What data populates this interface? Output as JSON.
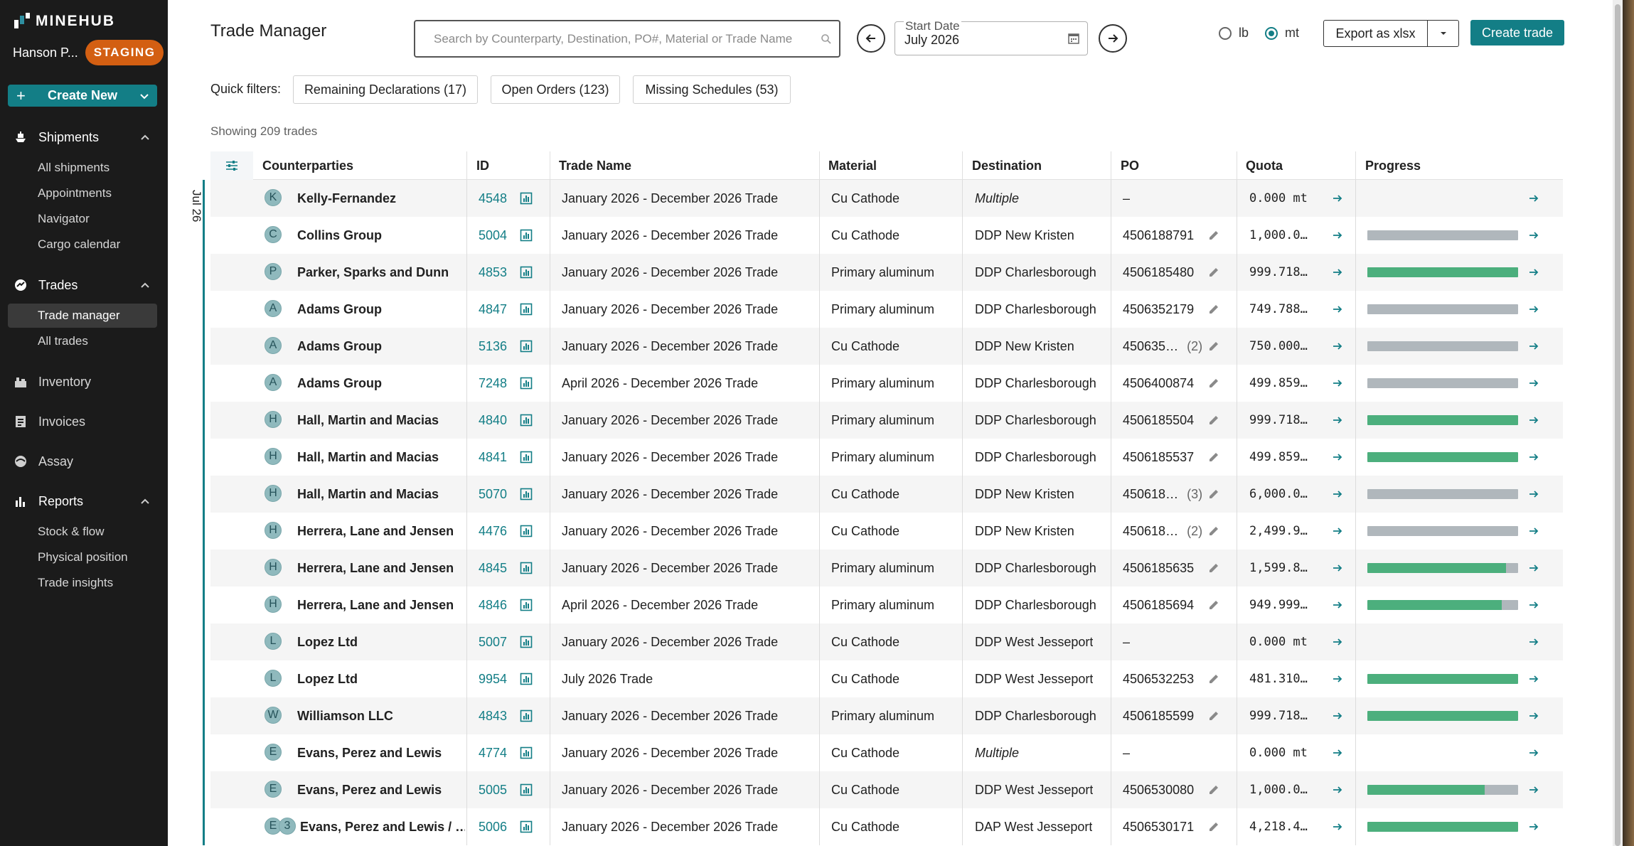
{
  "brand": {
    "name": "MINEHUB"
  },
  "user": {
    "name": "Hanson P...",
    "env_badge": "STAGING"
  },
  "sidebar": {
    "create_new": "Create New",
    "sections": [
      {
        "label": "Shipments",
        "icon": "ship-icon",
        "items": [
          "All shipments",
          "Appointments",
          "Navigator",
          "Cargo calendar"
        ]
      },
      {
        "label": "Trades",
        "icon": "trades-icon",
        "items": [
          "Trade manager",
          "All trades"
        ],
        "active_item": "Trade manager"
      },
      {
        "label": "Inventory",
        "icon": "inventory-icon",
        "items": []
      },
      {
        "label": "Invoices",
        "icon": "invoice-icon",
        "items": []
      },
      {
        "label": "Assay",
        "icon": "assay-icon",
        "items": []
      },
      {
        "label": "Reports",
        "icon": "reports-icon",
        "items": [
          "Stock & flow",
          "Physical position",
          "Trade insights"
        ]
      }
    ]
  },
  "header": {
    "title": "Trade Manager",
    "search_placeholder": "Search by Counterparty, Destination, PO#, Material or Trade Name",
    "start_date_label": "Start Date",
    "start_date_value": "July 2026",
    "unit_lb": "lb",
    "unit_mt": "mt",
    "selected_unit": "mt",
    "export_label": "Export as xlsx",
    "create_trade_label": "Create trade"
  },
  "quick_filters": {
    "label": "Quick filters:",
    "chips": [
      "Remaining Declarations (17)",
      "Open Orders (123)",
      "Missing Schedules (53)"
    ]
  },
  "showing_text": "Showing 209 trades",
  "table": {
    "month_label": "Jul 26",
    "columns": [
      "Counterparties",
      "ID",
      "Trade Name",
      "Material",
      "Destination",
      "PO",
      "Quota",
      "Progress"
    ],
    "rows": [
      {
        "avatars": [
          "K"
        ],
        "counterparty": "Kelly-Fernandez",
        "id": "4548",
        "trade_name": "January 2026 - December 2026 Trade",
        "material": "Cu Cathode",
        "destination": "Multiple",
        "dest_italic": true,
        "po": "–",
        "po_extra": "",
        "po_editable": false,
        "quota": "0.000 mt",
        "progress": []
      },
      {
        "avatars": [
          "C"
        ],
        "counterparty": "Collins Group",
        "id": "5004",
        "trade_name": "January 2026 - December 2026 Trade",
        "material": "Cu Cathode",
        "destination": "DDP New Kristen",
        "dest_italic": false,
        "po": "4506188791",
        "po_extra": "",
        "po_editable": true,
        "quota": "1,000.0…",
        "progress": [
          0,
          1.0
        ]
      },
      {
        "avatars": [
          "P"
        ],
        "counterparty": "Parker, Sparks and Dunn",
        "id": "4853",
        "trade_name": "January 2026 - December 2026 Trade",
        "material": "Primary aluminum",
        "destination": "DDP Charlesborough",
        "dest_italic": false,
        "po": "4506185480",
        "po_extra": "",
        "po_editable": true,
        "quota": "999.718…",
        "progress": [
          1.0,
          0
        ]
      },
      {
        "avatars": [
          "A"
        ],
        "counterparty": "Adams Group",
        "id": "4847",
        "trade_name": "January 2026 - December 2026 Trade",
        "material": "Primary aluminum",
        "destination": "DDP Charlesborough",
        "dest_italic": false,
        "po": "4506352179",
        "po_extra": "",
        "po_editable": true,
        "quota": "749.788…",
        "progress": [
          0,
          1.0
        ]
      },
      {
        "avatars": [
          "A"
        ],
        "counterparty": "Adams Group",
        "id": "5136",
        "trade_name": "January 2026 - December 2026 Trade",
        "material": "Cu Cathode",
        "destination": "DDP New Kristen",
        "dest_italic": false,
        "po": "450635…",
        "po_extra": "(2)",
        "po_editable": true,
        "quota": "750.000…",
        "progress": [
          0,
          1.0
        ]
      },
      {
        "avatars": [
          "A"
        ],
        "counterparty": "Adams Group",
        "id": "7248",
        "trade_name": "April 2026 - December 2026 Trade",
        "material": "Primary aluminum",
        "destination": "DDP Charlesborough",
        "dest_italic": false,
        "po": "4506400874",
        "po_extra": "",
        "po_editable": true,
        "quota": "499.859…",
        "progress": [
          0,
          1.0
        ]
      },
      {
        "avatars": [
          "H"
        ],
        "counterparty": "Hall, Martin and Macias",
        "id": "4840",
        "trade_name": "January 2026 - December 2026 Trade",
        "material": "Primary aluminum",
        "destination": "DDP Charlesborough",
        "dest_italic": false,
        "po": "4506185504",
        "po_extra": "",
        "po_editable": true,
        "quota": "999.718…",
        "progress": [
          1.0,
          0
        ]
      },
      {
        "avatars": [
          "H"
        ],
        "counterparty": "Hall, Martin and Macias",
        "id": "4841",
        "trade_name": "January 2026 - December 2026 Trade",
        "material": "Primary aluminum",
        "destination": "DDP Charlesborough",
        "dest_italic": false,
        "po": "4506185537",
        "po_extra": "",
        "po_editable": true,
        "quota": "499.859…",
        "progress": [
          1.0,
          0
        ]
      },
      {
        "avatars": [
          "H"
        ],
        "counterparty": "Hall, Martin and Macias",
        "id": "5070",
        "trade_name": "January 2026 - December 2026 Trade",
        "material": "Cu Cathode",
        "destination": "DDP New Kristen",
        "dest_italic": false,
        "po": "450618…",
        "po_extra": "(3)",
        "po_editable": true,
        "quota": "6,000.0…",
        "progress": [
          0,
          1.0
        ]
      },
      {
        "avatars": [
          "H"
        ],
        "counterparty": "Herrera, Lane and Jensen",
        "id": "4476",
        "trade_name": "January 2026 - December 2026 Trade",
        "material": "Cu Cathode",
        "destination": "DDP New Kristen",
        "dest_italic": false,
        "po": "450618…",
        "po_extra": "(2)",
        "po_editable": true,
        "quota": "2,499.9…",
        "progress": [
          0,
          1.0
        ]
      },
      {
        "avatars": [
          "H"
        ],
        "counterparty": "Herrera, Lane and Jensen",
        "id": "4845",
        "trade_name": "January 2026 - December 2026 Trade",
        "material": "Primary aluminum",
        "destination": "DDP Charlesborough",
        "dest_italic": false,
        "po": "4506185635",
        "po_extra": "",
        "po_editable": true,
        "quota": "1,599.8…",
        "progress": [
          0.92,
          0.08
        ]
      },
      {
        "avatars": [
          "H"
        ],
        "counterparty": "Herrera, Lane and Jensen",
        "id": "4846",
        "trade_name": "April 2026 - December 2026 Trade",
        "material": "Primary aluminum",
        "destination": "DDP Charlesborough",
        "dest_italic": false,
        "po": "4506185694",
        "po_extra": "",
        "po_editable": true,
        "quota": "949.999…",
        "progress": [
          0.89,
          0.11
        ]
      },
      {
        "avatars": [
          "L"
        ],
        "counterparty": "Lopez Ltd",
        "id": "5007",
        "trade_name": "January 2026 - December 2026 Trade",
        "material": "Cu Cathode",
        "destination": "DDP West Jesseport",
        "dest_italic": false,
        "po": "–",
        "po_extra": "",
        "po_editable": false,
        "quota": "0.000 mt",
        "progress": []
      },
      {
        "avatars": [
          "L"
        ],
        "counterparty": "Lopez Ltd",
        "id": "9954",
        "trade_name": "July 2026 Trade",
        "material": "Cu Cathode",
        "destination": "DDP West Jesseport",
        "dest_italic": false,
        "po": "4506532253",
        "po_extra": "",
        "po_editable": true,
        "quota": "481.310…",
        "progress": [
          1.0,
          0
        ]
      },
      {
        "avatars": [
          "W"
        ],
        "counterparty": "Williamson LLC",
        "id": "4843",
        "trade_name": "January 2026 - December 2026 Trade",
        "material": "Primary aluminum",
        "destination": "DDP Charlesborough",
        "dest_italic": false,
        "po": "4506185599",
        "po_extra": "",
        "po_editable": true,
        "quota": "999.718…",
        "progress": [
          1.0,
          0
        ]
      },
      {
        "avatars": [
          "E"
        ],
        "counterparty": "Evans, Perez and Lewis",
        "id": "4774",
        "trade_name": "January 2026 - December 2026 Trade",
        "material": "Cu Cathode",
        "destination": "Multiple",
        "dest_italic": true,
        "po": "–",
        "po_extra": "",
        "po_editable": false,
        "quota": "0.000 mt",
        "progress": []
      },
      {
        "avatars": [
          "E"
        ],
        "counterparty": "Evans, Perez and Lewis",
        "id": "5005",
        "trade_name": "January 2026 - December 2026 Trade",
        "material": "Cu Cathode",
        "destination": "DDP West Jesseport",
        "dest_italic": false,
        "po": "4506530080",
        "po_extra": "",
        "po_editable": true,
        "quota": "1,000.0…",
        "progress": [
          0.78,
          0.22
        ]
      },
      {
        "avatars": [
          "E",
          "3"
        ],
        "counterparty": "Evans, Perez and Lewis / …",
        "id": "5006",
        "trade_name": "January 2026 - December 2026 Trade",
        "material": "Cu Cathode",
        "destination": "DAP West Jesseport",
        "dest_italic": false,
        "po": "4506530171",
        "po_extra": "",
        "po_editable": true,
        "quota": "4,218.4…",
        "progress": [
          1.0,
          0
        ]
      }
    ]
  },
  "colors": {
    "accent": "#137e86",
    "progress_done": "#4caf7d",
    "progress_remaining": "#b0b7bc",
    "staging": "#d35f12"
  }
}
